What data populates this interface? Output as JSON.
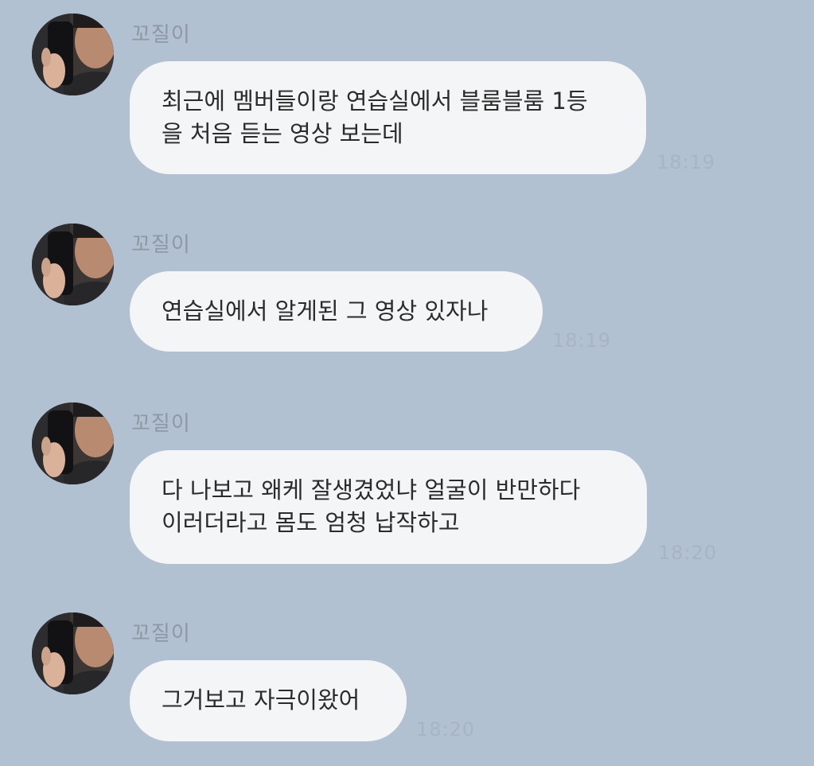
{
  "chat": {
    "messages": [
      {
        "sender": "꼬질이",
        "text": "최근에 멤버들이랑 연습실에서 블룸블룸 1등\n을 처음 듣는 영상 보는데",
        "time": "18:19"
      },
      {
        "sender": "꼬질이",
        "text": "연습실에서 알게된 그 영상 있자나",
        "time": "18:19"
      },
      {
        "sender": "꼬질이",
        "text": "다 나보고 왜케 잘생겼었냐 얼굴이 반만하다\n이러더라고  몸도 엄청 납작하고",
        "time": "18:20"
      },
      {
        "sender": "꼬질이",
        "text": "그거보고 자극이왔어",
        "time": "18:20"
      }
    ],
    "avatar_icon": "profile-photo",
    "colors": {
      "background": "#b1c1d2",
      "bubble": "#f4f5f7",
      "sender_text": "#8e98a4",
      "message_text": "#2b2b2b"
    }
  }
}
